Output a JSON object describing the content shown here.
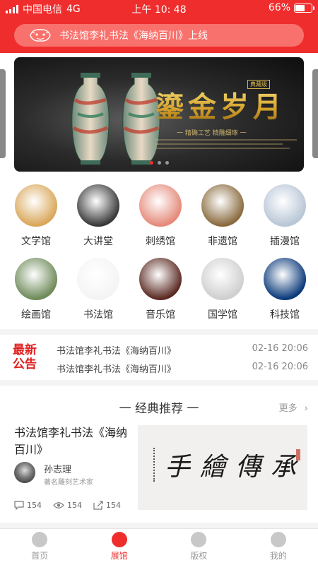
{
  "status_bar": {
    "carrier": "中国电信",
    "network": "4G",
    "time": "上午 10: 48",
    "battery": "66%",
    "battery_level": 0.66
  },
  "notice": {
    "text": "书法馆李礼书法《海纳百川》上线"
  },
  "banner": {
    "badge": "典藏级",
    "title": "鎏金岁月",
    "subtitle": "一 精确工艺  精雕细琢 一",
    "dot_count": 3,
    "active_dot": 0
  },
  "categories": [
    {
      "label": "文学馆",
      "color": "#d9a75a"
    },
    {
      "label": "大讲堂",
      "color": "#3a3a3a"
    },
    {
      "label": "刺绣馆",
      "color": "#e58a7a"
    },
    {
      "label": "非遗馆",
      "color": "#8a6b3f"
    },
    {
      "label": "插漫馆",
      "color": "#b8c6d6"
    },
    {
      "label": "绘画馆",
      "color": "#6f8b5a"
    },
    {
      "label": "书法馆",
      "color": "#f4f4f4"
    },
    {
      "label": "音乐馆",
      "color": "#5a2a22"
    },
    {
      "label": "国学馆",
      "color": "#cfcfcf"
    },
    {
      "label": "科技馆",
      "color": "#0b3a7a"
    }
  ],
  "news": {
    "logo_line1": "最新",
    "logo_line2": "公告",
    "items": [
      {
        "title": "书法馆李礼书法《海纳百川》",
        "date": "02-16  20:06"
      },
      {
        "title": "书法馆李礼书法《海纳百川》",
        "date": "02-16  20:06"
      }
    ]
  },
  "recommend": {
    "heading": "一  经典推荐  一",
    "more_label": "更多",
    "item": {
      "title": "书法馆李礼书法《海纳百川》",
      "author": "孙志理",
      "author_title": "著名雕刻艺术家",
      "comments": "154",
      "views": "154",
      "shares": "154",
      "calligraphy_text": "手繪傳承"
    }
  },
  "tabbar": {
    "tabs": [
      {
        "label": "首页",
        "icon": "home-icon"
      },
      {
        "label": "展馆",
        "icon": "museum-icon"
      },
      {
        "label": "版权",
        "icon": "shield-icon"
      },
      {
        "label": "我的",
        "icon": "profile-icon"
      }
    ],
    "active": 1
  },
  "colors": {
    "brand_red": "#f02d2d",
    "gold": "#d6a32c"
  }
}
